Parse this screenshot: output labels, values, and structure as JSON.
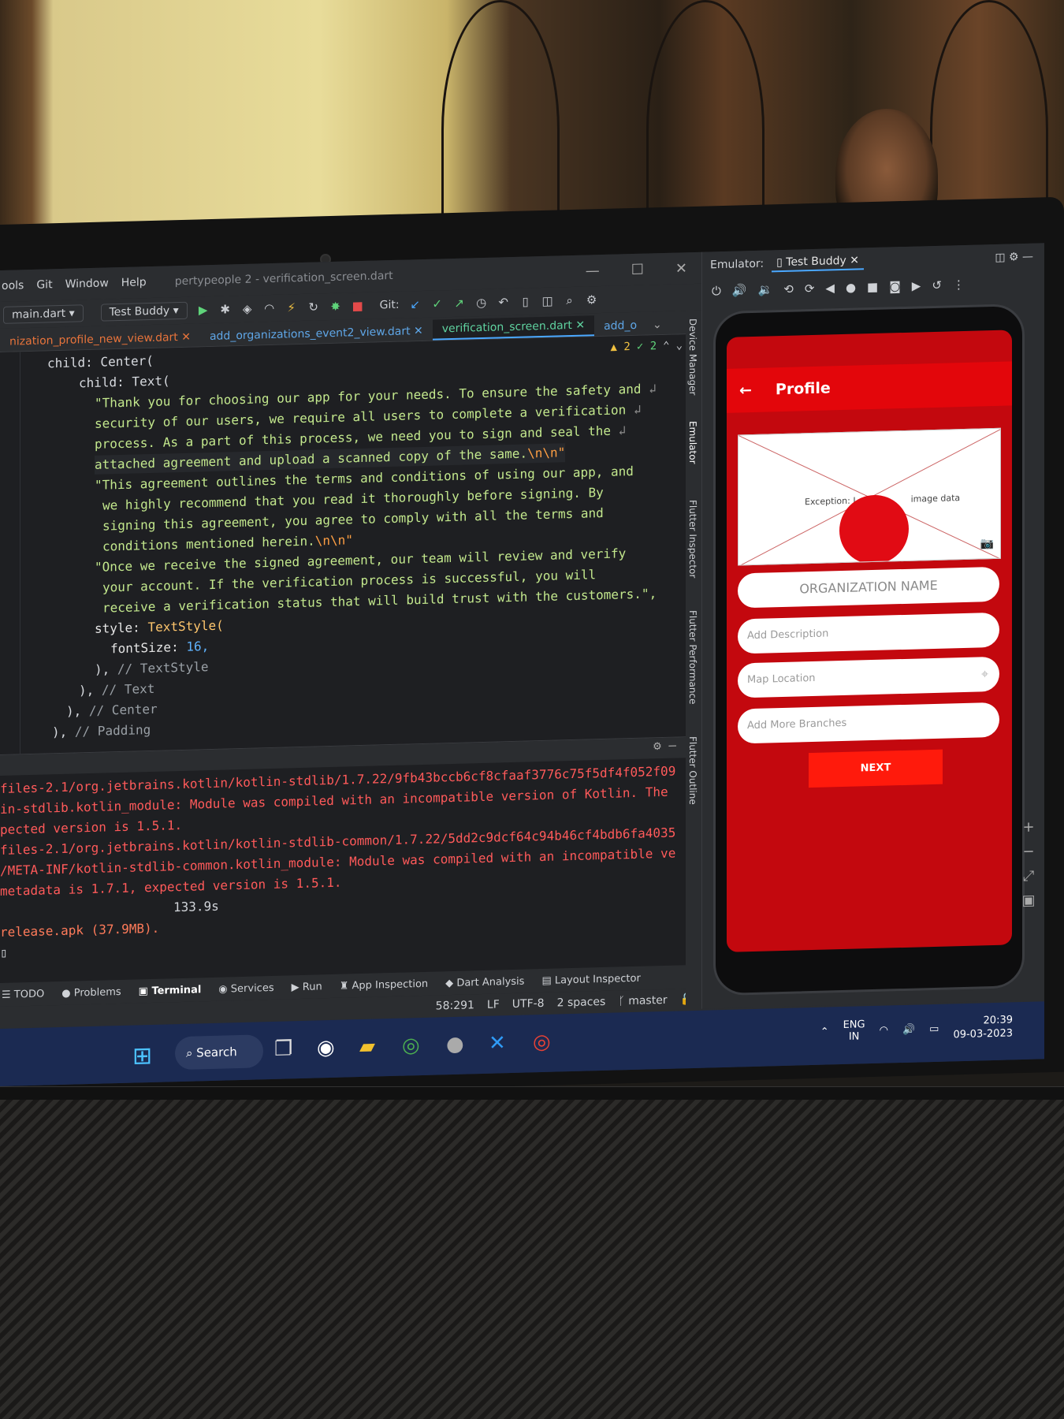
{
  "window": {
    "menu": [
      "ools",
      "Git",
      "Window",
      "Help"
    ],
    "title": "pertypeople 2 - verification_screen.dart"
  },
  "toolbar": {
    "file_selector": "main.dart",
    "device_selector": "Test Buddy",
    "git_label": "Git:"
  },
  "editor_tabs": [
    "nization_profile_new_view.dart",
    "add_organizations_event2_view.dart",
    "verification_screen.dart",
    "add_o"
  ],
  "inspections": {
    "warnings": "2",
    "ok": "2"
  },
  "code": [
    "child: Center(",
    "child: Text(",
    "\"Thank you for choosing our app for your needs. To ensure the safety and",
    "security of our users, we require all users to complete a verification",
    "process. As a part of this process, we need you to sign and seal the",
    "attached agreement and upload a scanned copy of the same.",
    "\"This agreement outlines the terms and conditions of using our app, and",
    "we highly recommend that you read it thoroughly before signing. By",
    "signing this agreement, you agree to comply with all the terms and",
    "conditions mentioned herein.",
    "\"Once we receive the signed agreement, our team will review and verify",
    "your account. If the verification process is successful, you will",
    "receive a verification status that will build trust with the customers.\",",
    "style:",
    "TextStyle(",
    "fontSize:",
    "16,",
    "),",
    "// TextStyle",
    "),",
    "// Text",
    "),",
    "// Center",
    "),",
    "// Padding"
  ],
  "code_escape": "\\n\\n\"",
  "terminal": [
    "files-2.1/org.jetbrains.kotlin/kotlin-stdlib/1.7.22/9fb43bccb6cf8cfaaf3776c75f5df4f052f09",
    "in-stdlib.kotlin_module: Module was compiled with an incompatible version of Kotlin. The",
    "pected version is 1.5.1.",
    "files-2.1/org.jetbrains.kotlin/kotlin-stdlib-common/1.7.22/5dd2c9dcf64c94b46cf4bdb6fa4035",
    "/META-INF/kotlin-stdlib-common.kotlin_module: Module was compiled with an incompatible ve",
    "metadata is 1.7.1, expected version is 1.5.1.",
    "133.9s",
    "release.apk (37.9MB).",
    "▯"
  ],
  "bottom_tools": [
    "TODO",
    "Problems",
    "Terminal",
    "Services",
    "Run",
    "App Inspection",
    "Dart Analysis",
    "Layout Inspector"
  ],
  "status": {
    "position": "58:291",
    "line_sep": "LF",
    "encoding": "UTF-8",
    "indent": "2 spaces",
    "branch": "master"
  },
  "side_tools": [
    "Device Manager",
    "Emulator",
    "Flutter Inspector",
    "Flutter Performance",
    "Flutter Outline"
  ],
  "emulator": {
    "label": "Emulator:",
    "device_tab": "Test Buddy"
  },
  "app": {
    "title": "Profile",
    "image_error": "Exception: I",
    "image_error_tail": "image data",
    "org_name_placeholder": "ORGANIZATION NAME",
    "description_placeholder": "Add Description",
    "location_placeholder": "Map Location",
    "branches_placeholder": "Add More Branches",
    "next_label": "NEXT"
  },
  "taskbar": {
    "search_label": "Search",
    "lang_top": "ENG",
    "lang_bottom": "IN",
    "time": "20:39",
    "date": "09-03-2023"
  },
  "colors": {
    "app_red": "#e3060b",
    "error_text": "#ff5a5a",
    "taskbar": "#1b2a52"
  }
}
